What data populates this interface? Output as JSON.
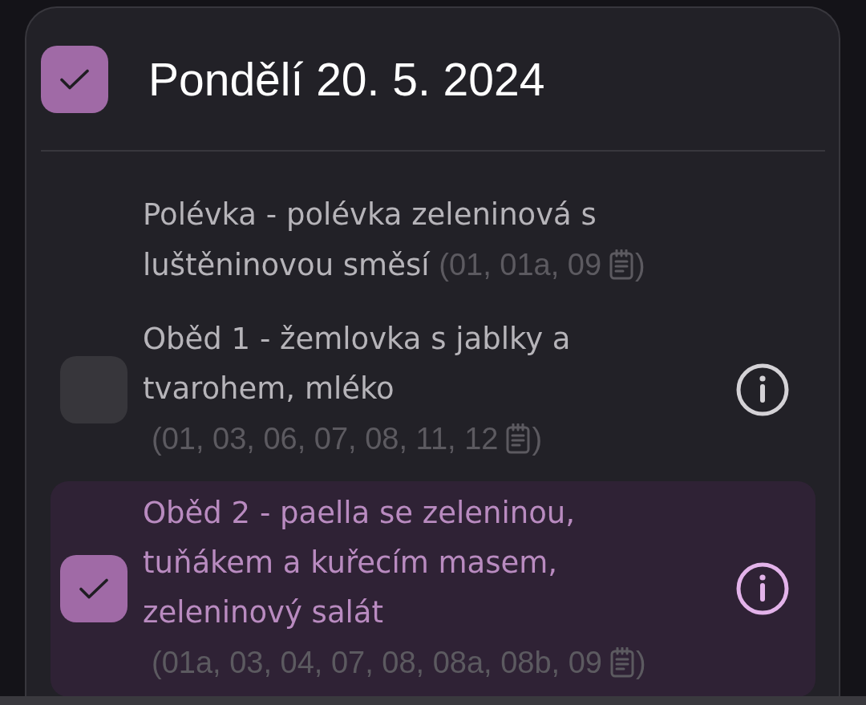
{
  "day": {
    "title": "Pondělí 20. 5. 2024",
    "checked": true
  },
  "meals": [
    {
      "kind": "soup",
      "name": "Polévka - polévka zeleninová s luštěninovou směsí",
      "allergens": "(01, 01a, 09",
      "allergens_end": ")"
    },
    {
      "kind": "meal",
      "name": "Oběd 1 - žemlovka s jablky a tvarohem, mléko",
      "allergens": "(01, 03, 06, 07, 08, 11, 12",
      "allergens_end": ")",
      "checked": false
    },
    {
      "kind": "meal",
      "name": "Oběd 2 - paella se zeleninou, tuňákem a kuřecím masem, zeleninový salát",
      "allergens": "(01a, 03, 04, 07, 08, 08a, 08b, 09",
      "allergens_end": ")",
      "checked": true
    }
  ]
}
